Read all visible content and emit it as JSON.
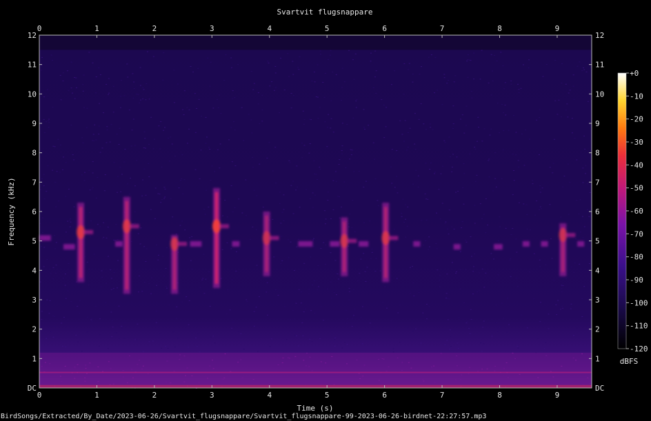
{
  "chart_data": {
    "type": "heatmap",
    "title": "Svartvit flugsnappare",
    "xlabel": "Time (s)",
    "ylabel": "Frequency (kHz)",
    "xlim": [
      0,
      9.6
    ],
    "ylim": [
      0,
      12
    ],
    "x_ticks": [
      "0",
      "1",
      "2",
      "3",
      "4",
      "5",
      "6",
      "7",
      "8",
      "9"
    ],
    "y_ticks": [
      "DC",
      "1",
      "2",
      "3",
      "4",
      "5",
      "6",
      "7",
      "8",
      "9",
      "10",
      "11",
      "12"
    ],
    "colorbar": {
      "label": "dBFS",
      "ticks": [
        "+0",
        "-10",
        "-20",
        "-30",
        "-40",
        "-50",
        "-60",
        "-70",
        "-80",
        "-90",
        "-100",
        "-110",
        "-120"
      ],
      "range": [
        -120,
        0
      ],
      "colormap": [
        "#000000",
        "#1a0a4a",
        "#3a0f8a",
        "#7a12a8",
        "#c0187a",
        "#ec2e3a",
        "#ff7a10",
        "#ffd530",
        "#ffffff"
      ]
    },
    "background": {
      "noise_cutoff_khz": 11.5,
      "low_band_khz": [
        0,
        1.2
      ]
    },
    "calls": [
      {
        "t": 0.72,
        "f_low": 3.6,
        "f_high": 6.3,
        "peak": 5.3,
        "intensity": 0.75
      },
      {
        "t": 1.52,
        "f_low": 3.2,
        "f_high": 6.5,
        "peak": 5.5,
        "intensity": 0.7
      },
      {
        "t": 2.35,
        "f_low": 3.2,
        "f_high": 5.2,
        "peak": 4.9,
        "intensity": 0.6
      },
      {
        "t": 3.08,
        "f_low": 3.4,
        "f_high": 6.8,
        "peak": 5.5,
        "intensity": 0.95
      },
      {
        "t": 3.95,
        "f_low": 3.8,
        "f_high": 6.0,
        "peak": 5.1,
        "intensity": 0.55
      },
      {
        "t": 5.3,
        "f_low": 3.8,
        "f_high": 5.8,
        "peak": 5.0,
        "intensity": 0.6
      },
      {
        "t": 6.02,
        "f_low": 3.6,
        "f_high": 6.3,
        "peak": 5.1,
        "intensity": 0.65
      },
      {
        "t": 9.1,
        "f_low": 3.8,
        "f_high": 5.6,
        "peak": 5.2,
        "intensity": 0.55
      }
    ],
    "faint_segments": [
      {
        "t0": 0.0,
        "t1": 0.2,
        "f": 5.1
      },
      {
        "t0": 0.42,
        "t1": 0.62,
        "f": 4.8
      },
      {
        "t0": 1.32,
        "t1": 1.45,
        "f": 4.9
      },
      {
        "t0": 2.62,
        "t1": 2.82,
        "f": 4.9
      },
      {
        "t0": 3.35,
        "t1": 3.48,
        "f": 4.9
      },
      {
        "t0": 4.5,
        "t1": 4.75,
        "f": 4.9
      },
      {
        "t0": 5.05,
        "t1": 5.22,
        "f": 4.9
      },
      {
        "t0": 5.55,
        "t1": 5.72,
        "f": 4.9
      },
      {
        "t0": 6.5,
        "t1": 6.62,
        "f": 4.9
      },
      {
        "t0": 7.2,
        "t1": 7.32,
        "f": 4.8
      },
      {
        "t0": 7.9,
        "t1": 8.05,
        "f": 4.8
      },
      {
        "t0": 8.4,
        "t1": 8.52,
        "f": 4.9
      },
      {
        "t0": 8.72,
        "t1": 8.84,
        "f": 4.9
      },
      {
        "t0": 9.35,
        "t1": 9.47,
        "f": 4.9
      }
    ]
  },
  "footer": {
    "path": "BirdSongs/Extracted/By_Date/2023-06-26/Svartvit_flugsnappare/Svartvit_flugsnappare-99-2023-06-26-birdnet-22:27:57.mp3"
  }
}
